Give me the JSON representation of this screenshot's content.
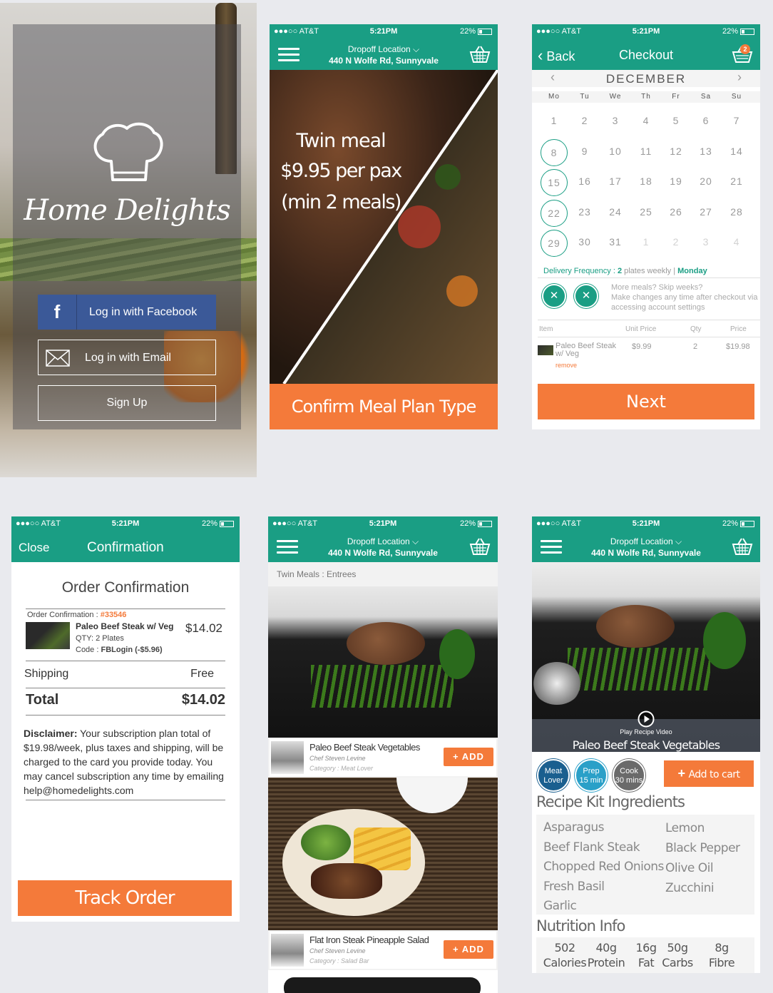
{
  "status": {
    "carrier": "●●●○○ AT&T",
    "time": "5:21PM",
    "battery": "22%"
  },
  "colors": {
    "teal": "#1a9e84",
    "orange": "#f47a3a"
  },
  "login": {
    "brand": "Home Delights",
    "facebook_btn": "Log in with Facebook",
    "email_btn": "Log in with Email",
    "signup_btn": "Sign Up",
    "icons": [
      "chef-hat-icon",
      "facebook-icon",
      "envelope-icon"
    ]
  },
  "header": {
    "dropoff_label": "Dropoff Location",
    "address": "440 N Wolfe Rd, Sunnyvale"
  },
  "mealplan": {
    "line1": "Twin meal",
    "line2": "$9.95 per pax",
    "line3": "(min 2 meals)",
    "confirm_btn": "Confirm Meal Plan Type"
  },
  "checkout": {
    "back": "Back",
    "title": "Checkout",
    "cart_count": "2",
    "month": "DECEMBER",
    "weekdays": [
      "Mo",
      "Tu",
      "We",
      "Th",
      "Fr",
      "Sa",
      "Su"
    ],
    "weeks": [
      [
        "1",
        "2",
        "3",
        "4",
        "5",
        "6",
        "7"
      ],
      [
        "8",
        "9",
        "10",
        "11",
        "12",
        "13",
        "14"
      ],
      [
        "15",
        "16",
        "17",
        "18",
        "19",
        "20",
        "21"
      ],
      [
        "22",
        "23",
        "24",
        "25",
        "26",
        "27",
        "28"
      ],
      [
        "29",
        "30",
        "31",
        "1",
        "2",
        "3",
        "4"
      ]
    ],
    "freq_label": "Delivery Frequency : ",
    "freq_num": "2",
    "freq_rest": " plates weekly",
    "freq_sep": " | ",
    "freq_day": "Monday",
    "more_meals": "More meals? Skip weeks?",
    "more_text": "Make changes any time after checkout via accessing account settings",
    "cols": [
      "Item",
      "Unit Price",
      "Qty",
      "Price"
    ],
    "item_name": "Paleo Beef Steak w/ Veg",
    "item_unit": "$9.99",
    "item_qty": "2",
    "item_price": "$19.98",
    "remove": "remove",
    "next": "Next"
  },
  "confirmation": {
    "close": "Close",
    "title": "Confirmation",
    "heading": "Order Confirmation",
    "order_label": "Order Confirmation : ",
    "order_no": "#33546",
    "item": "Paleo Beef Steak w/ Veg",
    "qty": "QTY: 2 Plates",
    "code_label": "Code : ",
    "code": "FBLogin (-$5.96)",
    "item_price": "$14.02",
    "shipping_label": "Shipping",
    "shipping_val": "Free",
    "total_label": "Total",
    "total_val": "$14.02",
    "disclaimer_bold": "Disclaimer:",
    "disclaimer": " Your subscription plan total of $19.98/week, plus taxes and shipping, will be charged to the card you provide today. You may cancel subscription any time by emailing help@homedelights.com",
    "track_btn": "Track Order"
  },
  "menu": {
    "section": "Twin Meals : Entrees",
    "items": [
      {
        "name": "Paleo Beef Steak Vegetables",
        "chef": "Chef Steven Levine",
        "category": "Category : Meat Lover",
        "add": "+ ADD"
      },
      {
        "name": "Flat Iron Steak Pineapple Salad",
        "chef": "Chef Steven Levine",
        "category": "Category : Salad Bar",
        "add": "+ ADD"
      }
    ]
  },
  "detail": {
    "play_label": "Play Recipe Video",
    "dish": "Paleo Beef Steak Vegetables",
    "badges": [
      {
        "l1": "Meat",
        "l2": "Lover",
        "color": "#1a5f8f"
      },
      {
        "l1": "Prep",
        "l2": "15 min",
        "color": "#2aa0c8"
      },
      {
        "l1": "Cook",
        "l2": "30 mins",
        "color": "#6a6a6a"
      }
    ],
    "add_cart": "Add to cart",
    "ing_title": "Recipe Kit Ingredients",
    "ingredients_left": [
      "Asparagus",
      "Beef Flank Steak",
      "Chopped Red Onions",
      "Fresh Basil",
      "Garlic"
    ],
    "ingredients_right": [
      "Lemon",
      "Black Pepper",
      "Olive Oil",
      "Zucchini"
    ],
    "nut_title": "Nutrition Info",
    "nutrition": [
      {
        "v": "502",
        "l": "Calories"
      },
      {
        "v": "40g",
        "l": "Protein"
      },
      {
        "v": "16g",
        "l": "Fat"
      },
      {
        "v": "50g",
        "l": "Carbs"
      },
      {
        "v": "8g",
        "l": "Fibre"
      }
    ]
  }
}
